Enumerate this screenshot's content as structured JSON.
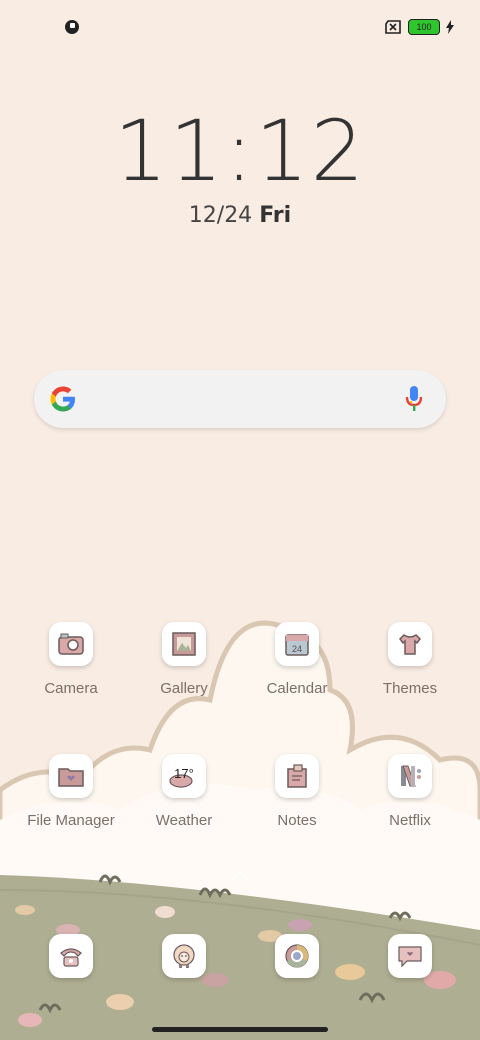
{
  "status": {
    "battery_level": "100",
    "left_icon": "notification-icon",
    "right_icons": [
      "sim-off-icon",
      "battery-icon",
      "charging-icon"
    ]
  },
  "clock": {
    "time": "11:12",
    "date": "12/24",
    "weekday": "Fri"
  },
  "search": {
    "placeholder": "",
    "left_icon": "google-logo-icon",
    "right_icon": "microphone-icon"
  },
  "apps": [
    {
      "label": "Camera",
      "icon": "camera-icon"
    },
    {
      "label": "Gallery",
      "icon": "gallery-icon"
    },
    {
      "label": "Calendar",
      "icon": "calendar-icon",
      "badge": "24"
    },
    {
      "label": "Themes",
      "icon": "themes-shirt-icon"
    },
    {
      "label": "File Manager",
      "icon": "folder-icon"
    },
    {
      "label": "Weather",
      "icon": "weather-icon",
      "badge": "17°"
    },
    {
      "label": "Notes",
      "icon": "notes-icon"
    },
    {
      "label": "Netflix",
      "icon": "netflix-icon"
    }
  ],
  "dock": [
    {
      "icon": "phone-icon"
    },
    {
      "icon": "sheep-icon"
    },
    {
      "icon": "chrome-icon"
    },
    {
      "icon": "messages-icon"
    }
  ],
  "colors": {
    "background": "#f8ece3",
    "icon_accent": "#c99a9a",
    "hill": "#a8a98c"
  }
}
